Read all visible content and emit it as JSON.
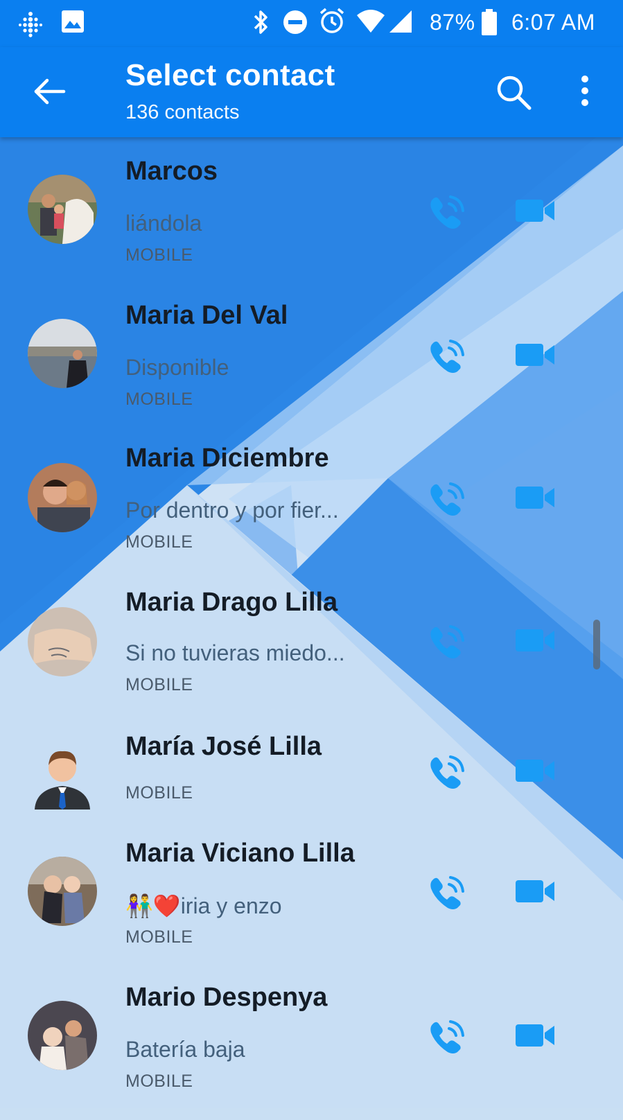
{
  "status_bar": {
    "battery": "87%",
    "time": "6:07 AM"
  },
  "app_bar": {
    "title": "Select contact",
    "subtitle": "136 contacts"
  },
  "icons": {
    "back": "arrow-left-icon",
    "search": "search-icon",
    "more": "more-vert-icon",
    "call": "phone-call-icon",
    "video": "video-camera-icon"
  },
  "colors": {
    "primary": "#0a7ff0",
    "accent": "#1a9cf5"
  },
  "contacts": [
    {
      "name": "Marcos",
      "status": "liándola",
      "type": "MOBILE"
    },
    {
      "name": "Maria Del Val",
      "status": "Disponible",
      "type": "MOBILE"
    },
    {
      "name": "Maria Diciembre",
      "status": "Por dentro y por fier...",
      "type": "MOBILE"
    },
    {
      "name": "Maria Drago Lilla",
      "status": "Si no tuvieras miedo...",
      "type": "MOBILE"
    },
    {
      "name": "María José Lilla",
      "status": "",
      "type": "MOBILE"
    },
    {
      "name": "Maria Viciano Lilla",
      "status": "👫❤️iria y enzo",
      "type": "MOBILE"
    },
    {
      "name": "Mario Despenya",
      "status": "Batería baja",
      "type": "MOBILE"
    }
  ]
}
